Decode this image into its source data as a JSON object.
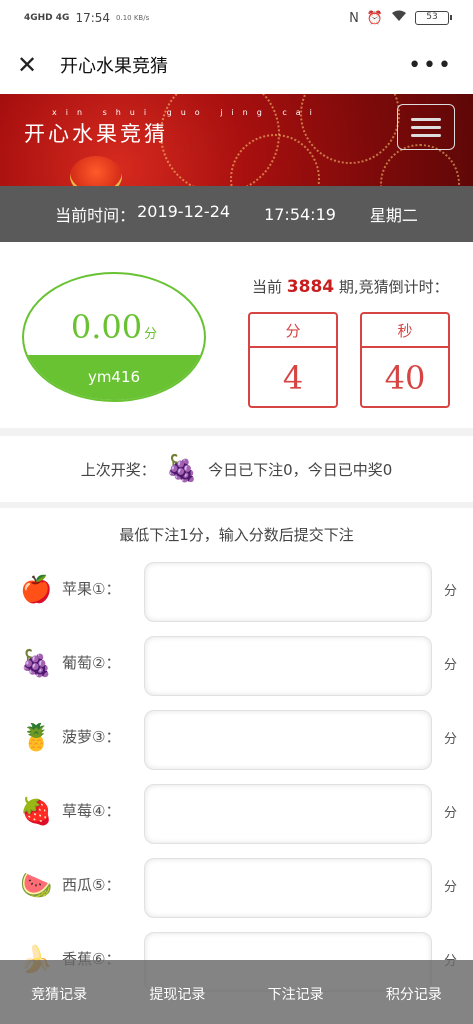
{
  "status_bar": {
    "network": "4GHD 4G",
    "time": "17:54",
    "speed": "0.10 KB/s",
    "battery": "53"
  },
  "header": {
    "title": "开心水果竞猜",
    "close_icon": "close-icon",
    "more_icon": "more-icon"
  },
  "banner": {
    "title": "开心水果竞猜",
    "pinyin": "xin shui guo jing cai"
  },
  "date_bar": {
    "label": "当前时间：",
    "date": "2019-12-24",
    "time": "17:54:19",
    "weekday": "星期二"
  },
  "score": {
    "value": "0.00",
    "unit": "分",
    "username": "ym416",
    "fill_fraction": 0.36
  },
  "period": {
    "prefix": "当前",
    "number": "3884",
    "suffix": "期,竞猜倒计时："
  },
  "countdown": {
    "minutes_label": "分",
    "minutes": "4",
    "seconds_label": "秒",
    "seconds": "40"
  },
  "last_winner": {
    "label": "上次开奖：",
    "fruit_icon": "grape-icon",
    "today_bet": "今日已下注0，",
    "today_win": "今日已中奖0"
  },
  "bet_hint": "最低下注1分，输入分数后提交下注",
  "bets": [
    {
      "fruit": "apple",
      "label": "苹果①：",
      "unit": "分"
    },
    {
      "fruit": "grape",
      "label": "葡萄②：",
      "unit": "分"
    },
    {
      "fruit": "pineapple",
      "label": "菠萝③：",
      "unit": "分"
    },
    {
      "fruit": "strawberry",
      "label": "草莓④：",
      "unit": "分"
    },
    {
      "fruit": "watermelon",
      "label": "西瓜⑤：",
      "unit": "分"
    },
    {
      "fruit": "banana",
      "label": "香蕉⑥：",
      "unit": "分"
    }
  ],
  "nav": [
    "竞猜记录",
    "提现记录",
    "下注记录",
    "积分记录"
  ]
}
